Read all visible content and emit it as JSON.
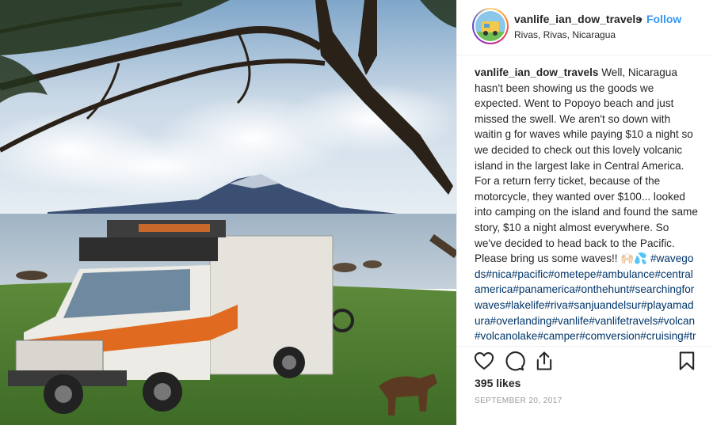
{
  "post": {
    "image_description": "",
    "header": {
      "username": "vanlife_ian_dow_travels",
      "separator": "•",
      "follow_label": "Follow",
      "location": "Rivas, Rivas, Nicaragua"
    },
    "caption": {
      "username": "vanlife_ian_dow_travels",
      "text": "Well, Nicaragua hasn't been showing us the goods we expected. Went to Popoyo beach and just missed the swell. We aren't so down with waitin g for waves while paying $10 a night so we decided to check out this lovely volcanic island in the largest lake in Central America. For a return ferry ticket, because of the motorcycle, they wanted over $100... looked into camping on the island and found the same story, $10 a night almost everywhere. So we've decided to head back to the Pacific. Please bring us some waves!! 🙌🏻💦",
      "hashtags": "#wavegods#nica#pacific#ometepe#ambulance#centralamerica#panamerica#onthehunt#searchingforwaves#lakelife#riva#sanjuandelsur#playamadura#overlanding#vanlife#vanlifetravels#volcan#volcanolake#camper#comversion#cruising#travel#vantravel#surfin"
    },
    "actions": {
      "like_icon": "heart-icon",
      "comment_icon": "comment-icon",
      "share_icon": "share-icon",
      "save_icon": "bookmark-icon"
    },
    "likes": "395 likes",
    "date": "SEPTEMBER 20, 2017"
  },
  "colors": {
    "follow": "#3897f0",
    "hashtag": "#003569",
    "text": "#262626",
    "muted": "#999999"
  }
}
